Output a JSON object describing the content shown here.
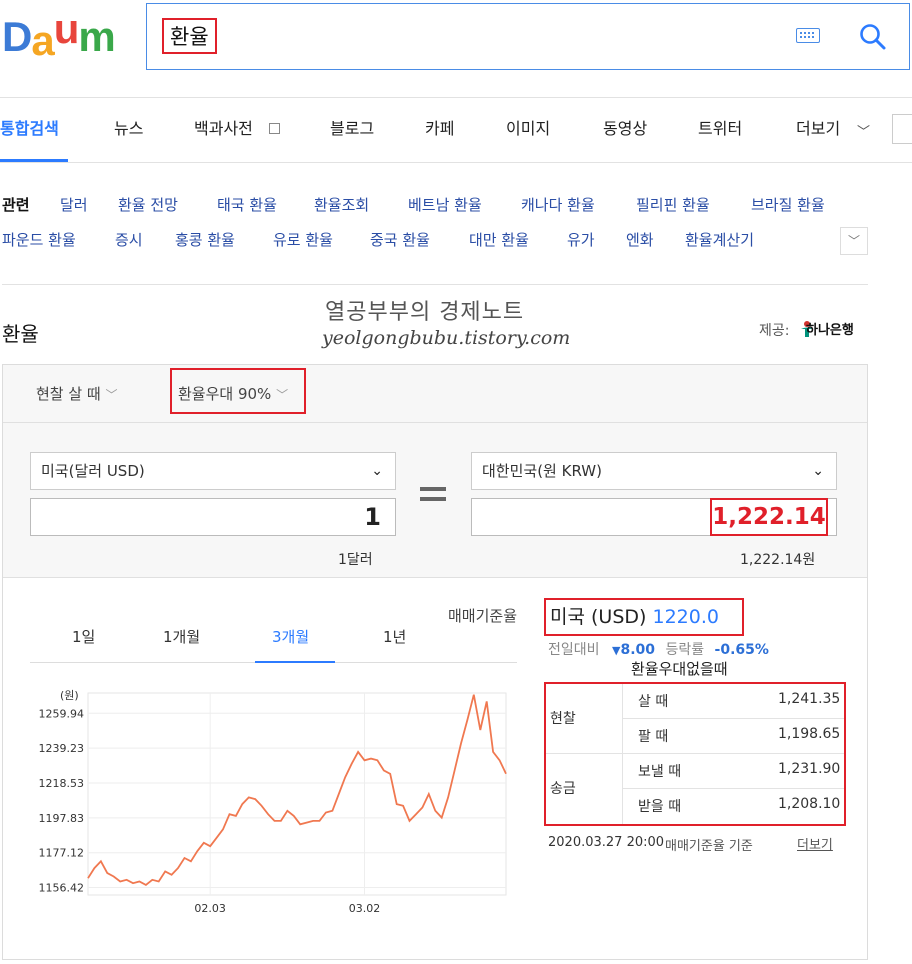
{
  "logo": {
    "letters": [
      "D",
      "a",
      "u",
      "m"
    ],
    "colors": [
      "#3c7bd6",
      "#f5a623",
      "#e8453c",
      "#3aa84a"
    ]
  },
  "search": {
    "query": "환율"
  },
  "tabs": [
    "통합검색",
    "뉴스",
    "백과사전",
    "블로그",
    "카페",
    "이미지",
    "동영상",
    "트위터",
    "더보기"
  ],
  "related": {
    "label": "관련",
    "row1": [
      "달러",
      "환율 전망",
      "태국 환율",
      "환율조회",
      "베트남 환율",
      "캐나다 환율",
      "필리핀 환율",
      "브라질 환율"
    ],
    "row2": [
      "파운드 환율",
      "증시",
      "홍콩 환율",
      "유로 환율",
      "중국 환율",
      "대만 환율",
      "유가",
      "엔화",
      "환율계산기"
    ]
  },
  "section": {
    "title": "환율",
    "provider_label": "제공:",
    "provider": "하나은행"
  },
  "watermark": {
    "line1": "열공부부의 경제노트",
    "line2": "yeolgongbubu.tistory.com"
  },
  "options": {
    "cash_type": "현찰 살 때",
    "preferential": "환율우대 90%"
  },
  "converter": {
    "from_currency": "미국(달러 USD)",
    "from_amount": "1",
    "from_caption": "1달러",
    "to_currency": "대한민국(원 KRW)",
    "to_amount": "1,222.14",
    "to_caption": "1,222.14원"
  },
  "periods": {
    "items": [
      "1일",
      "1개월",
      "3개월",
      "1년"
    ],
    "active": "3개월"
  },
  "rate": {
    "label": "매매기준율",
    "country": "미국 (USD)",
    "value": "1220.0",
    "prev_label": "전일대비",
    "prev_value": "8.00",
    "pct_label": "등락률",
    "pct_value": "-0.65%",
    "table_title": "환율우대없을때",
    "rows": [
      {
        "group": "현찰",
        "label": "살 때",
        "value": "1,241.35"
      },
      {
        "group": "",
        "label": "팔 때",
        "value": "1,198.65"
      },
      {
        "group": "송금",
        "label": "보낼 때",
        "value": "1,231.90"
      },
      {
        "group": "",
        "label": "받을 때",
        "value": "1,208.10"
      }
    ],
    "timestamp": "2020.03.27 20:00",
    "basis": "매매기준율 기준",
    "more": "더보기"
  },
  "chart_data": {
    "type": "line",
    "unit_label": "(원)",
    "y_ticks": [
      "1259.94",
      "1239.23",
      "1218.53",
      "1197.83",
      "1177.12",
      "1156.42"
    ],
    "x_ticks": [
      "02.03",
      "03.02"
    ],
    "ylim": [
      1152,
      1272
    ],
    "series": [
      {
        "values": [
          1162,
          1168,
          1172,
          1165,
          1163,
          1160,
          1161,
          1159,
          1160,
          1158,
          1161,
          1160,
          1166,
          1164,
          1168,
          1174,
          1172,
          1178,
          1183,
          1181,
          1186,
          1191,
          1200,
          1199,
          1206,
          1210,
          1209,
          1205,
          1200,
          1196,
          1196,
          1202,
          1199,
          1194,
          1195,
          1196,
          1196,
          1201,
          1202,
          1212,
          1222,
          1230,
          1237,
          1232,
          1233,
          1232,
          1226,
          1224,
          1206,
          1205,
          1196,
          1200,
          1204,
          1212,
          1202,
          1198,
          1210,
          1226,
          1242,
          1256,
          1271,
          1250,
          1267,
          1237,
          1232,
          1224
        ]
      }
    ],
    "color": "#f07850"
  }
}
